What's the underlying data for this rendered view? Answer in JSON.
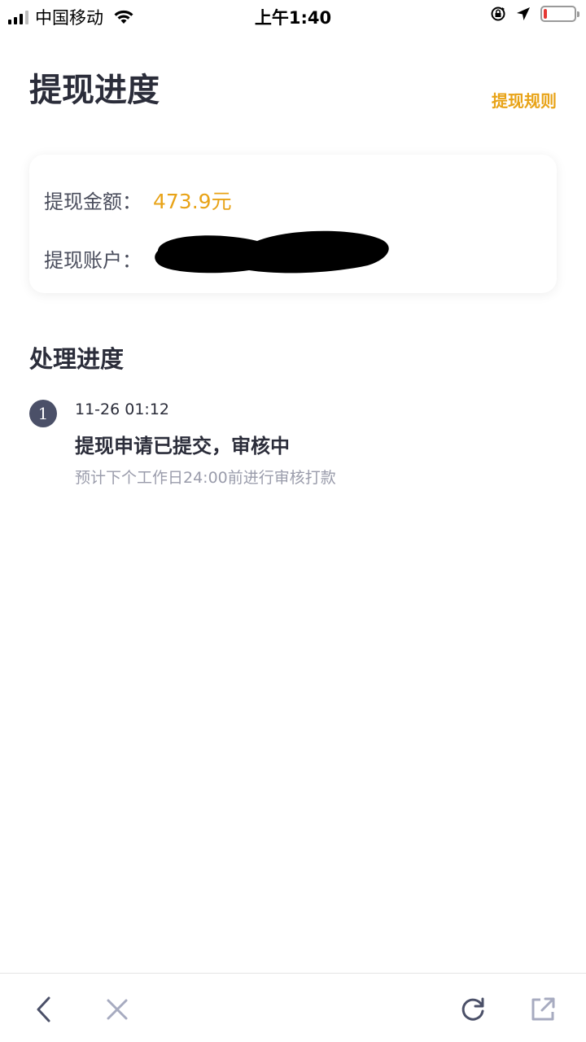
{
  "status_bar": {
    "carrier": "中国移动",
    "time": "上午1:40",
    "battery_level": 0.1,
    "battery_color": "#e53935",
    "icons": [
      "signal-icon",
      "wifi-icon",
      "rotation-lock-icon",
      "location-arrow-icon",
      "battery-icon"
    ]
  },
  "header": {
    "title": "提现进度",
    "rules_link": "提现规则",
    "accent_color": "#e8a317"
  },
  "card": {
    "amount_label": "提现金额：",
    "amount_value": "473.9元",
    "account_label": "提现账户："
  },
  "progress": {
    "title": "处理进度",
    "steps": [
      {
        "number": "1",
        "time": "11-26 01:12",
        "title": "提现申请已提交，审核中",
        "desc": "预计下个工作日24:00前进行审核打款"
      }
    ]
  },
  "toolbar": {
    "icons": [
      "back-icon",
      "close-icon",
      "refresh-icon",
      "share-icon"
    ]
  }
}
